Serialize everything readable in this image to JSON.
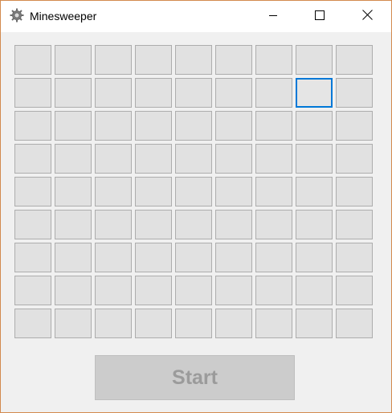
{
  "window": {
    "title": "Minesweeper",
    "icon": "gear-icon",
    "controls": {
      "minimize": "minimize-icon",
      "maximize": "maximize-icon",
      "close": "close-icon"
    }
  },
  "board": {
    "rows": 9,
    "cols": 9,
    "focused_cell": {
      "row": 2,
      "col": 8
    }
  },
  "start_button": {
    "label": "Start",
    "enabled": false
  },
  "colors": {
    "window_border": "#d38a4e",
    "cell_face": "#e1e1e1",
    "focus": "#0078d7",
    "disabled_text": "#9b9b9b"
  }
}
